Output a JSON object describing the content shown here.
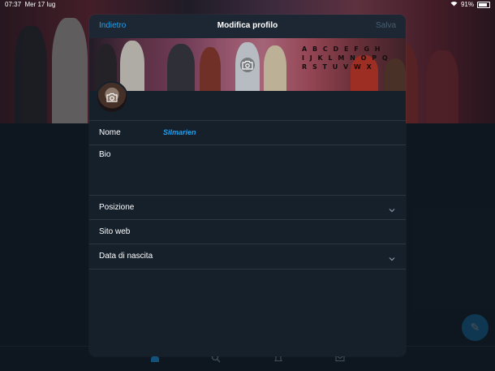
{
  "statusbar": {
    "time": "07:37",
    "date": "Mer 17 lug",
    "battery": "91%"
  },
  "modal": {
    "back_label": "Indietro",
    "title": "Modifica profilo",
    "save_label": "Salva"
  },
  "banner": {
    "letters_line1": "A B C D E F G H",
    "letters_line2": "I J K L M N O P Q",
    "letters_line3": "R S T U V W X"
  },
  "fields": {
    "name_label": "Nome",
    "name_value": "Silmarien",
    "bio_label": "Bio",
    "location_label": "Posizione",
    "website_label": "Sito web",
    "birthdate_label": "Data di nascita"
  },
  "colors": {
    "accent": "#1da1f2",
    "background": "#15202b",
    "divider": "#2a3642"
  },
  "icons": [
    "camera-icon",
    "chevron-down-icon",
    "compose-tweet-icon",
    "home-icon",
    "search-icon",
    "notifications-icon",
    "messages-icon",
    "wifi-icon",
    "battery-icon"
  ]
}
